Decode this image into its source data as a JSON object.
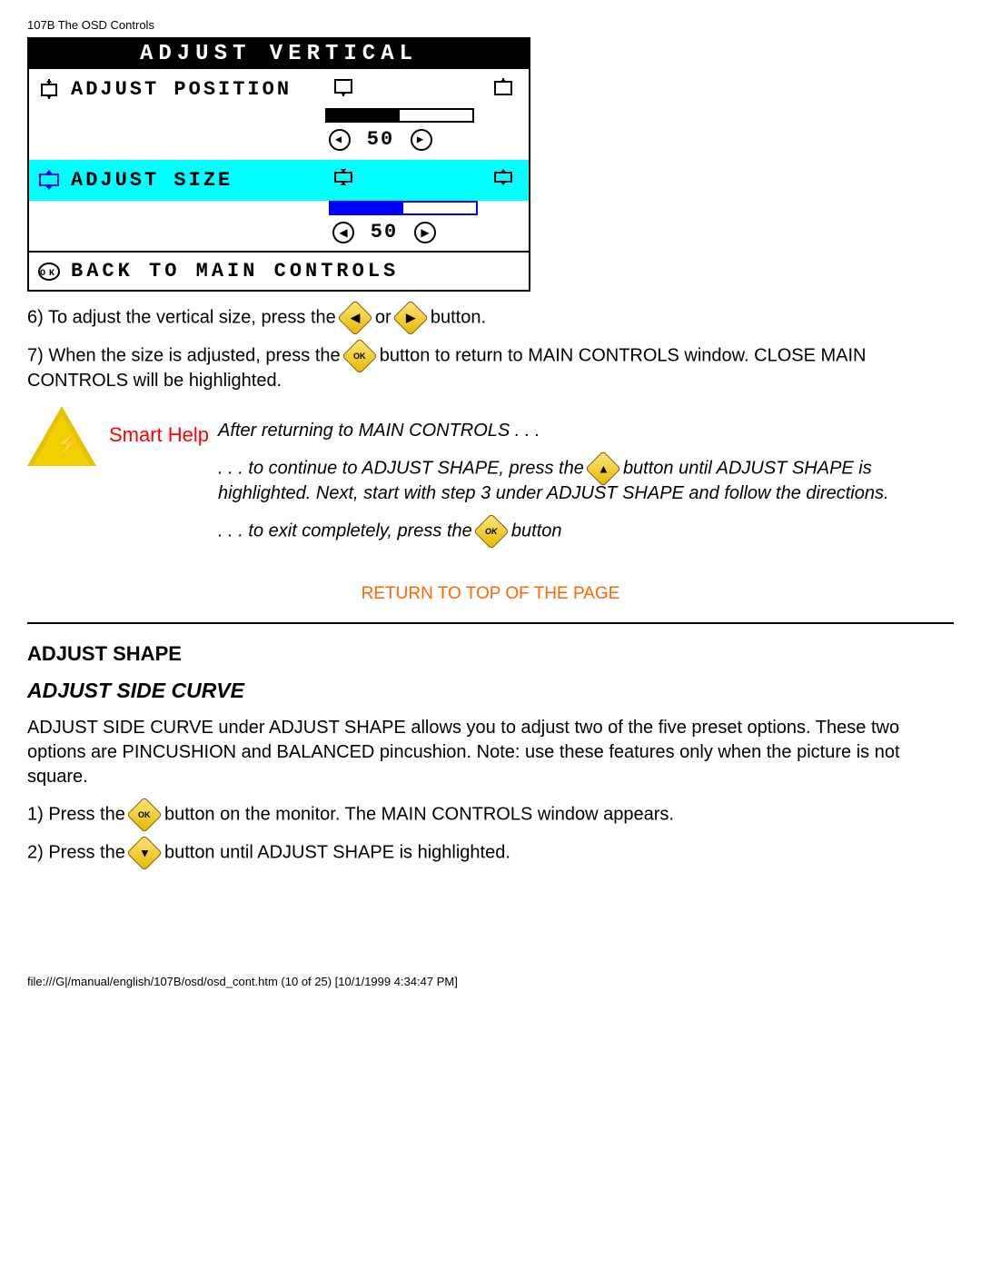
{
  "header": "107B The OSD Controls",
  "osd": {
    "title": "ADJUST VERTICAL",
    "row1": {
      "label": "ADJUST POSITION",
      "value": "50",
      "fill_pct": 50
    },
    "row2": {
      "label": "ADJUST SIZE",
      "value": "50",
      "fill_pct": 50
    },
    "back": "BACK TO MAIN CONTROLS"
  },
  "step6": {
    "prefix": "6) To adjust the vertical size, press the",
    "mid": "or",
    "suffix": "button."
  },
  "step7": {
    "prefix": "7) When the size is adjusted, press the ",
    "suffix": " button to return to MAIN CONTROLS window. CLOSE MAIN CONTROLS will be highlighted."
  },
  "smart_help": {
    "label": "Smart Help",
    "line1": "After returning to MAIN CONTROLS . . .",
    "line2a": ". . . to continue to ADJUST SHAPE, press the ",
    "line2b": " button until ADJUST SHAPE is highlighted. Next, start with step 3 under ADJUST SHAPE and follow the directions.",
    "line3a": ". . . to exit completely, press the ",
    "line3b": " button"
  },
  "return_link": "RETURN TO TOP OF THE PAGE",
  "section": {
    "heading": "ADJUST SHAPE",
    "subheading": "ADJUST SIDE CURVE",
    "intro": "ADJUST SIDE CURVE under ADJUST SHAPE allows you to adjust two of the five preset options. These two options are PINCUSHION and BALANCED pincushion. Note: use these features only when the picture is not square.",
    "step1a": "1) Press the ",
    "step1b": " button on the monitor. The MAIN CONTROLS window appears.",
    "step2a": "2) Press the ",
    "step2b": " button until ADJUST SHAPE is highlighted."
  },
  "footer": "file:///G|/manual/english/107B/osd/osd_cont.htm (10 of 25) [10/1/1999 4:34:47 PM]"
}
